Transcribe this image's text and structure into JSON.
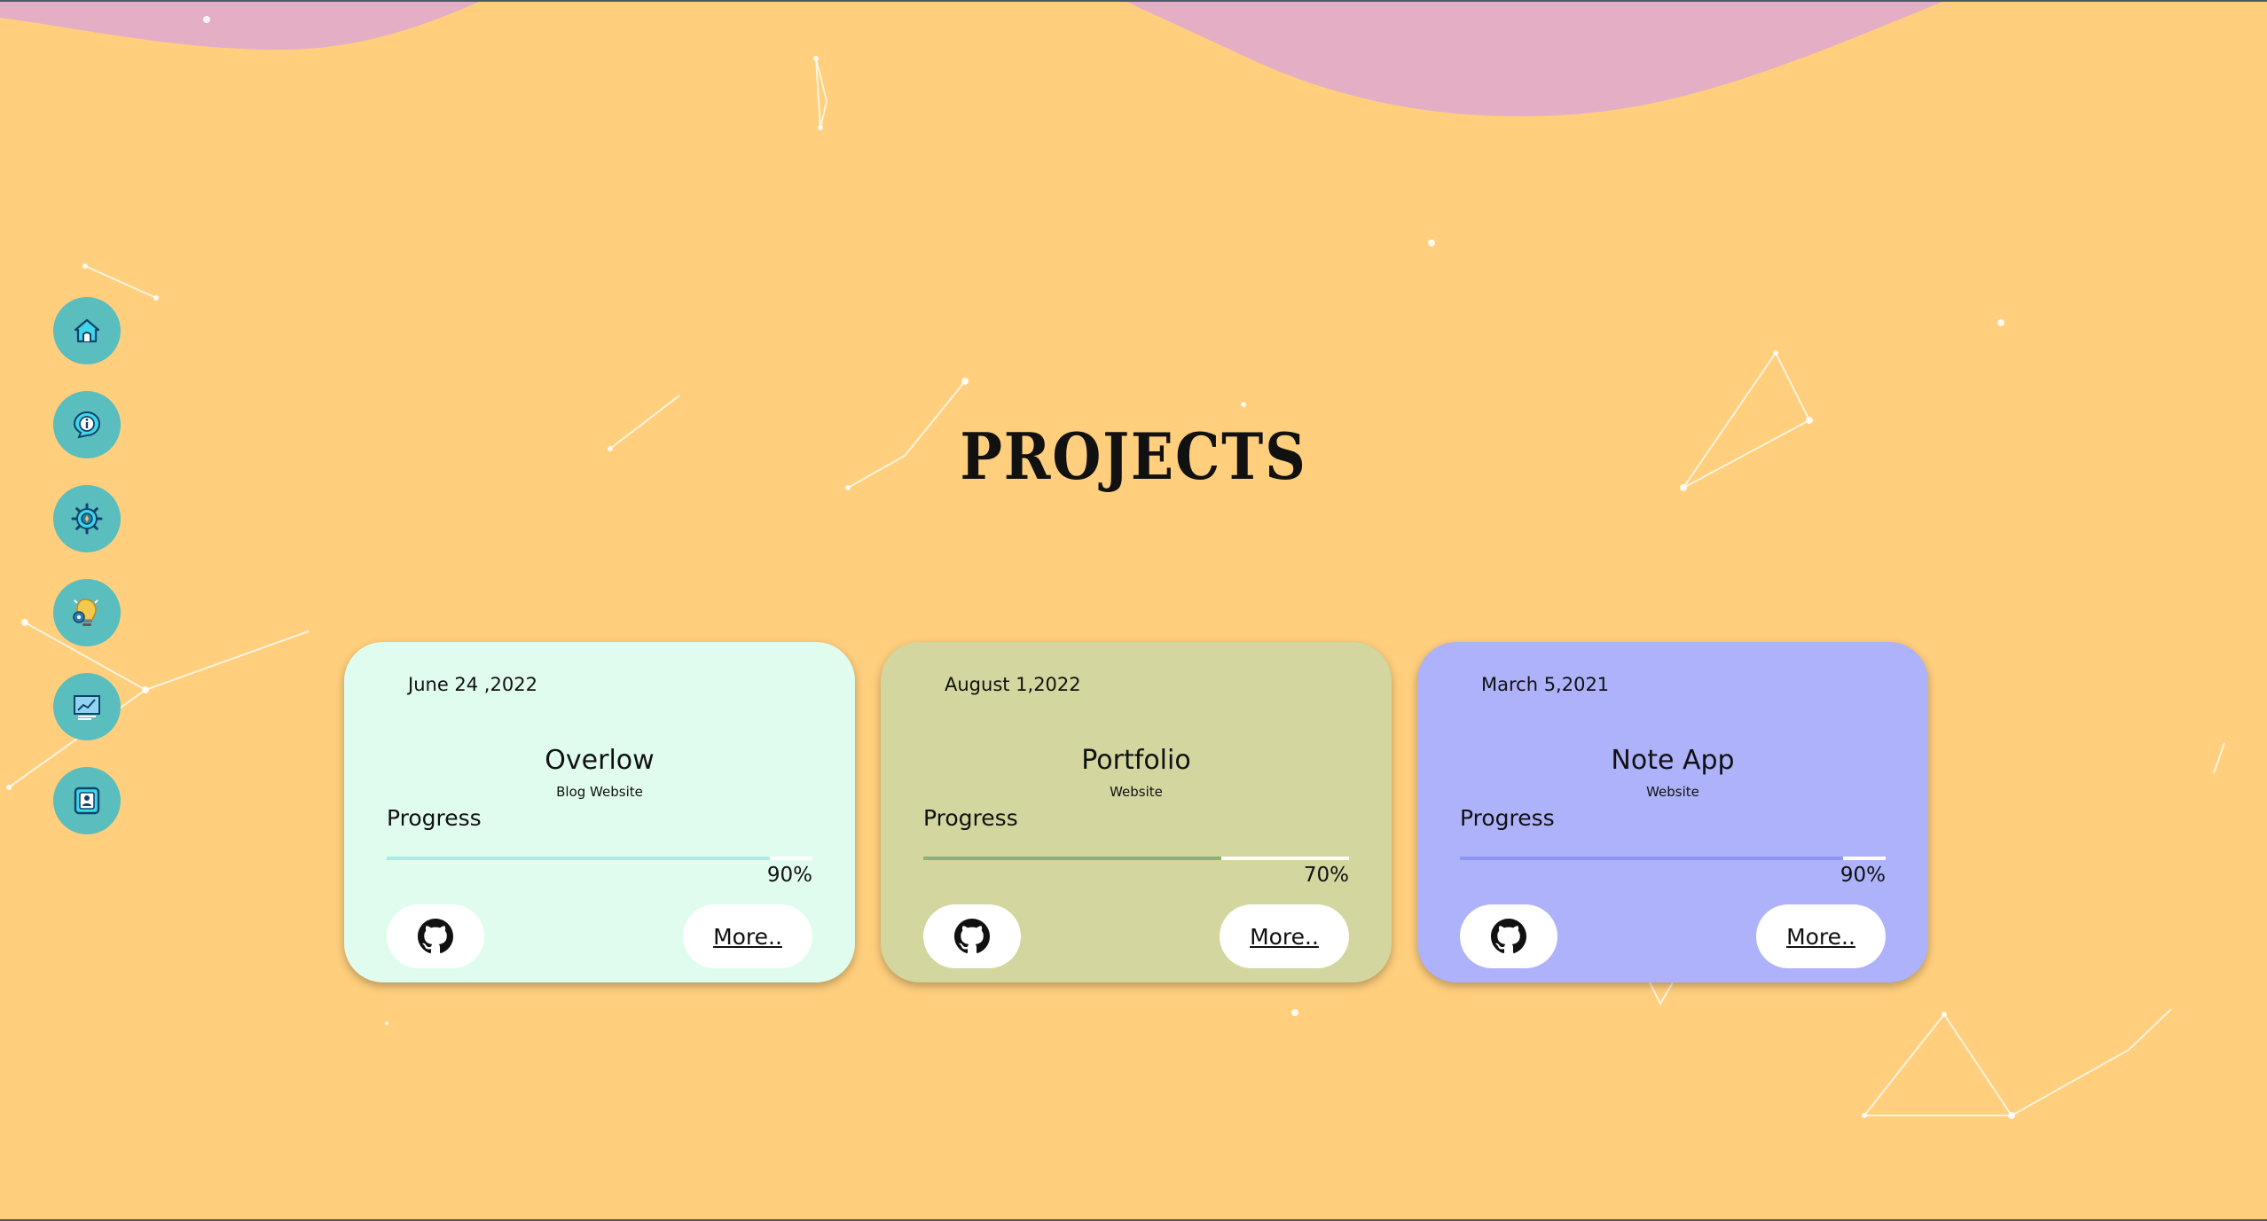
{
  "colors": {
    "background": "#FFCF7D",
    "wave": "#E4AFC5",
    "nav_button": "#5ABDBE",
    "nav_icon_fill": "#3FD6EA",
    "constellation": "#FFFFFF"
  },
  "nav": {
    "items": [
      {
        "name": "home",
        "icon": "home-icon"
      },
      {
        "name": "about",
        "icon": "info-icon"
      },
      {
        "name": "services",
        "icon": "gear-icon"
      },
      {
        "name": "skills",
        "icon": "lightbulb-gear-icon"
      },
      {
        "name": "projects",
        "icon": "chart-board-icon"
      },
      {
        "name": "contact",
        "icon": "contact-card-icon"
      }
    ]
  },
  "section": {
    "title": "PROJECTS"
  },
  "projects": [
    {
      "date": "June 24 ,2022",
      "title": "Overlow",
      "subtitle": "Blog Website",
      "progress_label": "Progress",
      "progress": 90,
      "progress_text": "90%",
      "more_label": "More..",
      "github_icon": "github-icon",
      "card_color": "#E0FCEE",
      "bar_color": "#A8EDE3"
    },
    {
      "date": "August 1,2022",
      "title": "Portfolio",
      "subtitle": "Website",
      "progress_label": "Progress",
      "progress": 70,
      "progress_text": "70%",
      "more_label": "More..",
      "github_icon": "github-icon",
      "card_color": "#D3D69F",
      "bar_color": "#87B27A"
    },
    {
      "date": "March 5,2021",
      "title": "Note App",
      "subtitle": "Website",
      "progress_label": "Progress",
      "progress": 90,
      "progress_text": "90%",
      "more_label": "More..",
      "github_icon": "github-icon",
      "card_color": "#ADB2FA",
      "bar_color": "#8F95F2"
    }
  ]
}
